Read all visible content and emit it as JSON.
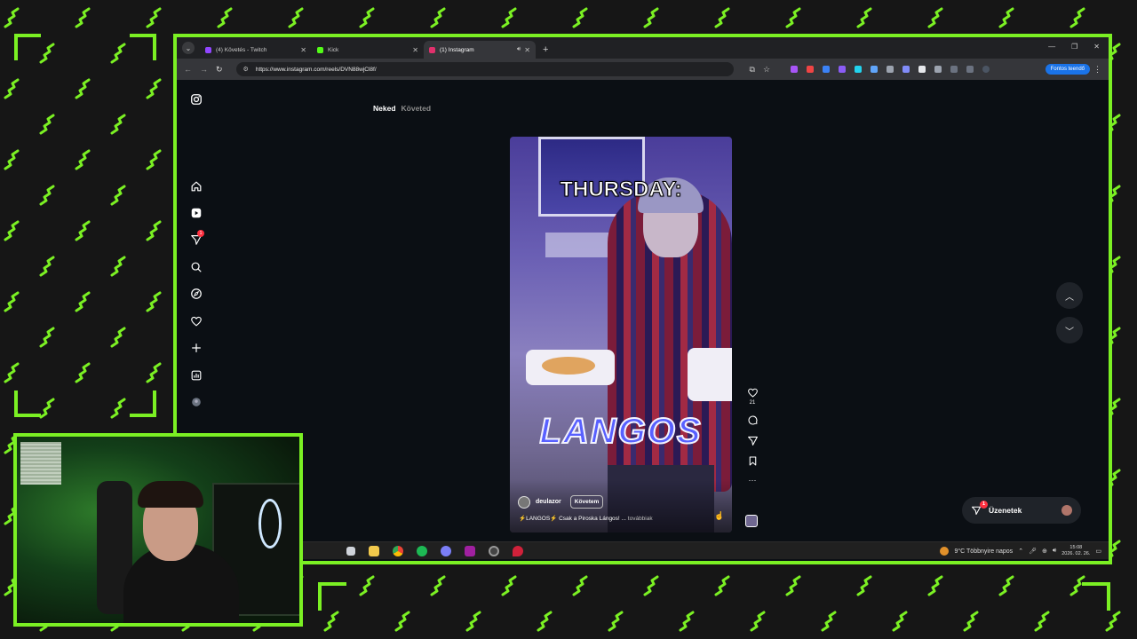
{
  "theme": {
    "accent": "#7bf023",
    "background": "#161616"
  },
  "browser": {
    "tabs": [
      {
        "label": "(4) Követés - Twitch",
        "favicon_color": "#9146ff",
        "active": false
      },
      {
        "label": "Kick",
        "favicon_color": "#53fc18",
        "active": false
      },
      {
        "label": "(1) Instagram",
        "favicon_color": "#e1306c",
        "active": true
      }
    ],
    "url": "https://www.instagram.com/reels/DVN88wjCl8f/",
    "profile_label": "Fontos teendő",
    "icons": [
      "back-icon",
      "forward-icon",
      "reload-icon",
      "site-settings-icon",
      "install-icon",
      "bookmark-star-icon",
      "download-icon",
      "menu-icon"
    ]
  },
  "instagram": {
    "feed_tabs": {
      "for_you": "Neked",
      "following": "Követed"
    },
    "sidebar_notification_badge": "1",
    "reel": {
      "overlay_top": "THURSDAY:",
      "overlay_bottom": "LANGOS",
      "author": "deulazor",
      "follow_label": "Követem",
      "caption": "⚡LANGOS⚡ Csak a Piroska Lángos! ...",
      "caption_more": "továbbiak",
      "likes": "21",
      "more_label": "···"
    },
    "messages": {
      "label": "Üzenetek",
      "badge": "1"
    }
  },
  "taskbar": {
    "weather": "9°C  Többnyire napos",
    "time": "15:08",
    "date": "2026. 02. 26."
  }
}
